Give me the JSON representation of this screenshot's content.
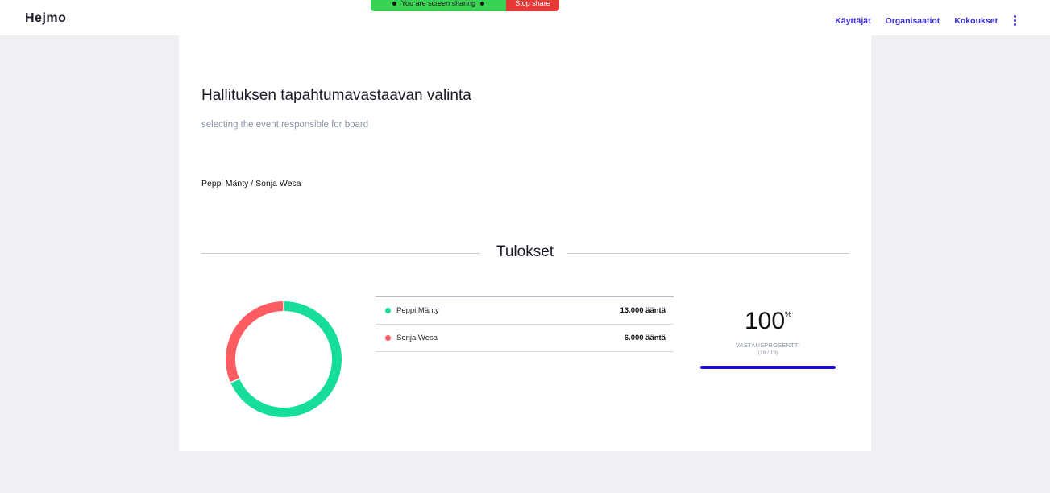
{
  "app": {
    "brand": "Hejmo"
  },
  "share_banner": {
    "text": "You are screen sharing",
    "stop_label": "Stop share"
  },
  "nav": {
    "items": [
      "Käyttäjät",
      "Organisaatiot",
      "Kokoukset"
    ]
  },
  "poll": {
    "title": "Hallituksen tapahtumavastaavan valinta",
    "description": "selecting the event responsible for board",
    "candidates_text": "Peppi Mänty / Sonja Wesa",
    "results_heading": "Tulokset"
  },
  "results": [
    {
      "name": "Peppi Mänty",
      "votes": 13,
      "votes_label": "13.000 ääntä",
      "color": "#16de9a"
    },
    {
      "name": "Sonja Wesa",
      "votes": 6,
      "votes_label": "6.000 ääntä",
      "color": "#fc5c62"
    }
  ],
  "participation": {
    "value": "100",
    "unit": "%",
    "label": "VASTAUSPROSENTTI",
    "count": "(19 / 19)",
    "fraction": 1.0,
    "bar_color": "#1e0ccc"
  },
  "colors": {
    "accent": "#3b2fd6",
    "background": "#f0f0f4"
  }
}
